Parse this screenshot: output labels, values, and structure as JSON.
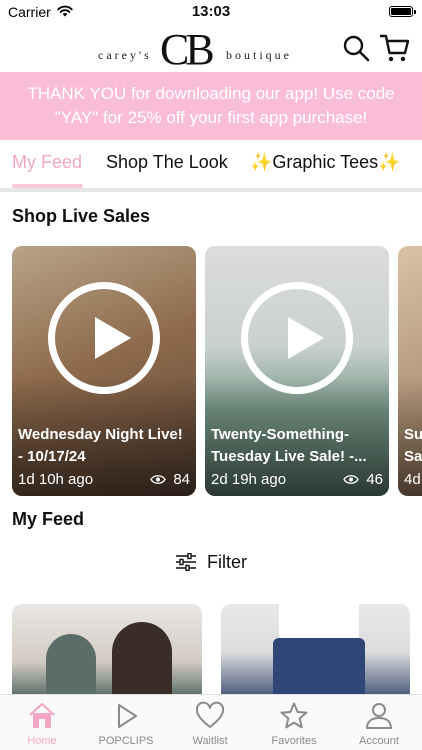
{
  "status_bar": {
    "carrier": "Carrier",
    "time": "13:03"
  },
  "header": {
    "logo_left": "carey's",
    "logo_monogram": "CB",
    "logo_right": "boutique",
    "icons": [
      "search-icon",
      "cart-icon"
    ]
  },
  "promo": {
    "text": "THANK YOU for downloading our app! Use code \"YAY\" for 25% off your first app purchase!"
  },
  "tabs": [
    {
      "label": "My Feed",
      "active": true
    },
    {
      "label": "Shop The Look",
      "active": false
    },
    {
      "label": "✨Graphic Tees✨",
      "active": false
    }
  ],
  "live_sales": {
    "title": "Shop Live Sales",
    "cards": [
      {
        "title": "Wednesday Night Live! - 10/17/24",
        "age": "1d 10h ago",
        "views": "84"
      },
      {
        "title": "Twenty-Something-Tuesday Live Sale! -...",
        "age": "2d 19h ago",
        "views": "46"
      },
      {
        "title": "Su Sa",
        "age": "4d",
        "views": ""
      }
    ]
  },
  "feed": {
    "title": "My Feed",
    "filter_label": "Filter"
  },
  "bottom_nav": [
    {
      "label": "Home",
      "icon": "home-icon",
      "active": true
    },
    {
      "label": "POPCLIPS",
      "icon": "play-icon",
      "active": false
    },
    {
      "label": "Waitlist",
      "icon": "heart-icon",
      "active": false
    },
    {
      "label": "Favorites",
      "icon": "star-icon",
      "active": false
    },
    {
      "label": "Account",
      "icon": "person-icon",
      "active": false
    }
  ],
  "colors": {
    "accent_pink": "#f3a6c6",
    "banner_pink": "#f9bed6"
  }
}
